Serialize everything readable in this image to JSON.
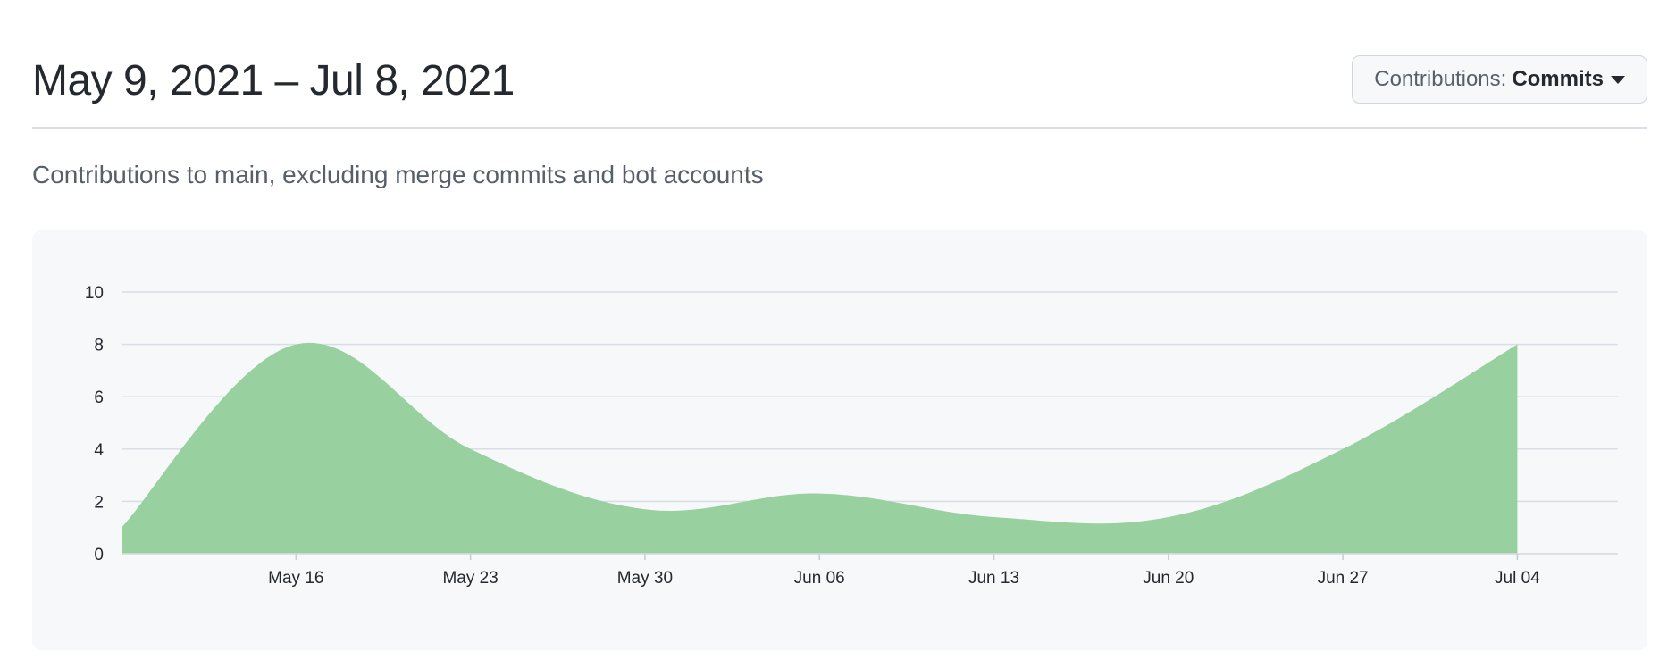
{
  "header": {
    "date_range": "May 9, 2021 – Jul 8, 2021",
    "contributions_label": "Contributions:",
    "contributions_value": "Commits"
  },
  "description": "Contributions to main, excluding merge commits and bot accounts",
  "colors": {
    "area_fill": "#98d0a0",
    "gridline": "#d8dee4",
    "panel_bg": "#f6f8fa"
  },
  "chart_data": {
    "type": "area",
    "title": "",
    "xlabel": "",
    "ylabel": "",
    "ylim": [
      0,
      10
    ],
    "y_ticks": [
      0,
      2,
      4,
      6,
      8,
      10
    ],
    "x_ticks": [
      "May 16",
      "May 23",
      "May 30",
      "Jun 06",
      "Jun 13",
      "Jun 20",
      "Jun 27",
      "Jul 04"
    ],
    "grid": true,
    "legend": false,
    "series": [
      {
        "x": [
          "2021-05-09",
          "2021-05-16",
          "2021-05-23",
          "2021-05-30",
          "2021-06-06",
          "2021-06-13",
          "2021-06-20",
          "2021-06-27",
          "2021-07-04"
        ],
        "values": [
          1,
          8,
          4,
          1.7,
          2.3,
          1.4,
          1.4,
          4,
          8
        ]
      }
    ]
  }
}
